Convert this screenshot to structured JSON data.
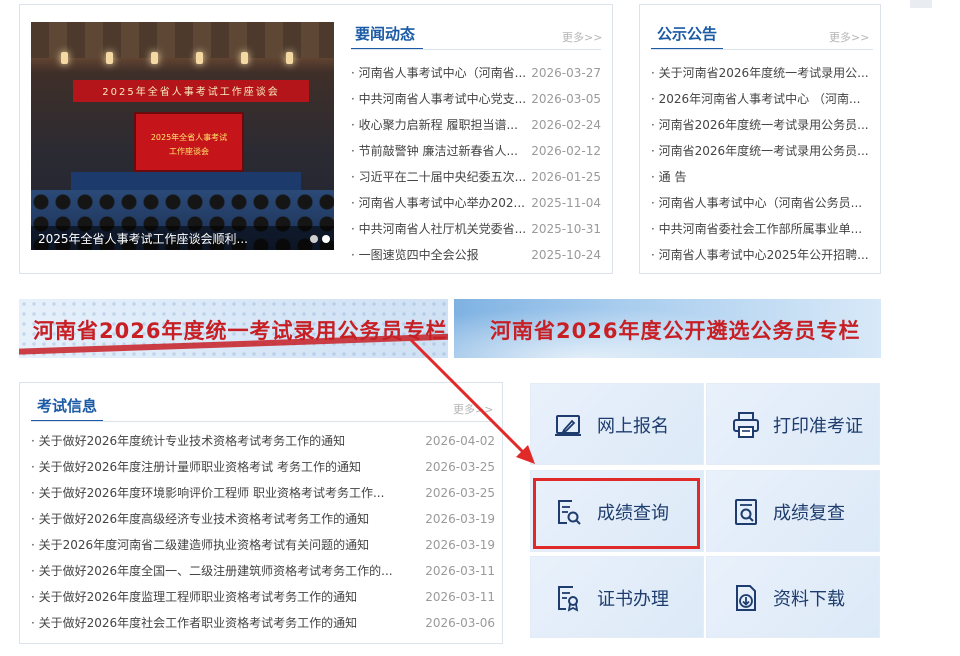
{
  "news": {
    "title": "要闻动态",
    "more": "更多>>",
    "photo": {
      "banner_text": "2025年全省人事考试工作座谈会",
      "screen_line1": "2025年全省人事考试",
      "screen_line2": "工作座谈会",
      "caption": "2025年全省人事考试工作座谈会顺利..."
    },
    "items": [
      {
        "title": "· 河南省人事考试中心（河南省...",
        "date": "2026-03-27"
      },
      {
        "title": "· 中共河南省人事考试中心党支...",
        "date": "2026-03-05"
      },
      {
        "title": "· 收心聚力启新程 履职担当谱...",
        "date": "2026-02-24"
      },
      {
        "title": "· 节前敲警钟 廉洁过新春省人...",
        "date": "2026-02-12"
      },
      {
        "title": "· 习近平在二十届中央纪委五次...",
        "date": "2026-01-25"
      },
      {
        "title": "· 河南省人事考试中心举办202...",
        "date": "2025-11-04"
      },
      {
        "title": "· 中共河南省人社厅机关党委省...",
        "date": "2025-10-31"
      },
      {
        "title": "· 一图速览四中全会公报",
        "date": "2025-10-24"
      }
    ]
  },
  "notices": {
    "title": "公示公告",
    "more": "更多>>",
    "items": [
      "· 关于河南省2026年度统一考试录用公...",
      "· 2026年河南省人事考试中心 （河南...",
      "· 河南省2026年度统一考试录用公务员...",
      "· 河南省2026年度统一考试录用公务员...",
      "· 通 告",
      "· 河南省人事考试中心（河南省公务员...",
      "· 中共河南省委社会工作部所属事业单...",
      "· 河南省人事考试中心2025年公开招聘..."
    ]
  },
  "banners": {
    "a": "河南省2026年度统一考试录用公务员专栏",
    "b": "河南省2026年度公开遴选公务员专栏"
  },
  "exam": {
    "title": "考试信息",
    "more": "更多>>",
    "items": [
      {
        "title": "· 关于做好2026年度统计专业技术资格考试考务工作的通知",
        "date": "2026-04-02"
      },
      {
        "title": "· 关于做好2026年度注册计量师职业资格考试 考务工作的通知",
        "date": "2026-03-25"
      },
      {
        "title": "· 关于做好2026年度环境影响评价工程师 职业资格考试考务工作...",
        "date": "2026-03-25"
      },
      {
        "title": "· 关于做好2026年度高级经济专业技术资格考试考务工作的通知",
        "date": "2026-03-19"
      },
      {
        "title": "· 关于2026年度河南省二级建造师执业资格考试有关问题的通知",
        "date": "2026-03-19"
      },
      {
        "title": "· 关于做好2026年度全国一、二级注册建筑师资格考试考务工作的...",
        "date": "2026-03-11"
      },
      {
        "title": "· 关于做好2026年度监理工程师职业资格考试考务工作的通知",
        "date": "2026-03-11"
      },
      {
        "title": "· 关于做好2026年度社会工作者职业资格考试考务工作的通知",
        "date": "2026-03-06"
      }
    ]
  },
  "services": [
    {
      "label": "网上报名",
      "icon": "edit-form-icon"
    },
    {
      "label": "打印准考证",
      "icon": "printer-icon"
    },
    {
      "label": "成绩查询",
      "icon": "score-search-icon"
    },
    {
      "label": "成绩复查",
      "icon": "score-review-icon"
    },
    {
      "label": "证书办理",
      "icon": "certificate-icon"
    },
    {
      "label": "资料下载",
      "icon": "download-icon"
    }
  ],
  "colors": {
    "accent_blue": "#1b5aa5",
    "banner_red": "#c81f24",
    "highlight_red": "#e02a2a"
  }
}
